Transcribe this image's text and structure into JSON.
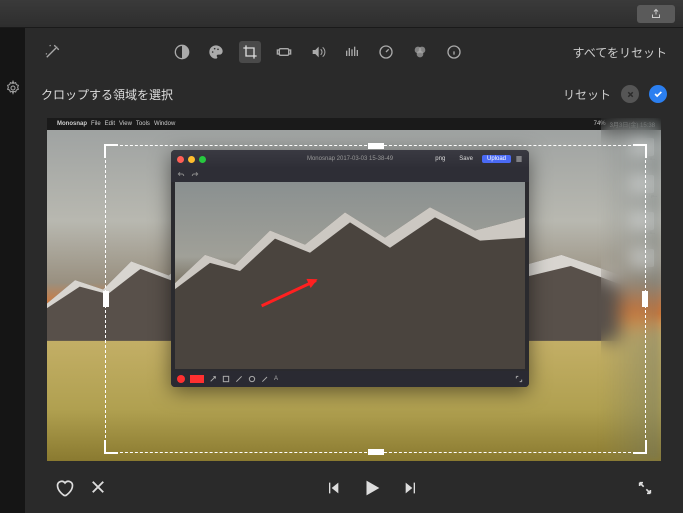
{
  "titlebar": {
    "share_icon": "share-icon"
  },
  "toolbar": {
    "wand_icon": "magic-wand-icon",
    "reset_all_label": "すべてをリセット",
    "tools": [
      {
        "name": "contrast-icon",
        "active": false
      },
      {
        "name": "palette-icon",
        "active": false
      },
      {
        "name": "crop-icon",
        "active": true
      },
      {
        "name": "stabilize-icon",
        "active": false
      },
      {
        "name": "volume-icon",
        "active": false
      },
      {
        "name": "equalizer-icon",
        "active": false
      },
      {
        "name": "speed-icon",
        "active": false
      },
      {
        "name": "color-balance-icon",
        "active": false
      },
      {
        "name": "info-icon",
        "active": false
      }
    ]
  },
  "crop_row": {
    "label": "クロップする領域を選択",
    "reset_label": "リセット"
  },
  "screenshot": {
    "mac_menu": {
      "apple": "",
      "app": "Monosnap",
      "items": [
        "File",
        "Edit",
        "View",
        "Tools",
        "Window"
      ],
      "right_status": "74%",
      "date": "3月3日(金) 15:38"
    },
    "monosnap": {
      "title": "Monosnap 2017-03-03 15-38-49",
      "format": "png",
      "save_label": "Save",
      "upload_label": "Upload"
    },
    "desktop_files": [
      "IMG_0228...",
      "IMG_0227.p...",
      "IMG_0226...",
      ""
    ]
  },
  "playback": {
    "favorite": "heart-icon",
    "reject": "reject-icon",
    "prev": "skip-back-icon",
    "play": "play-icon",
    "next": "skip-forward-icon",
    "fullscreen": "fullscreen-icon"
  }
}
